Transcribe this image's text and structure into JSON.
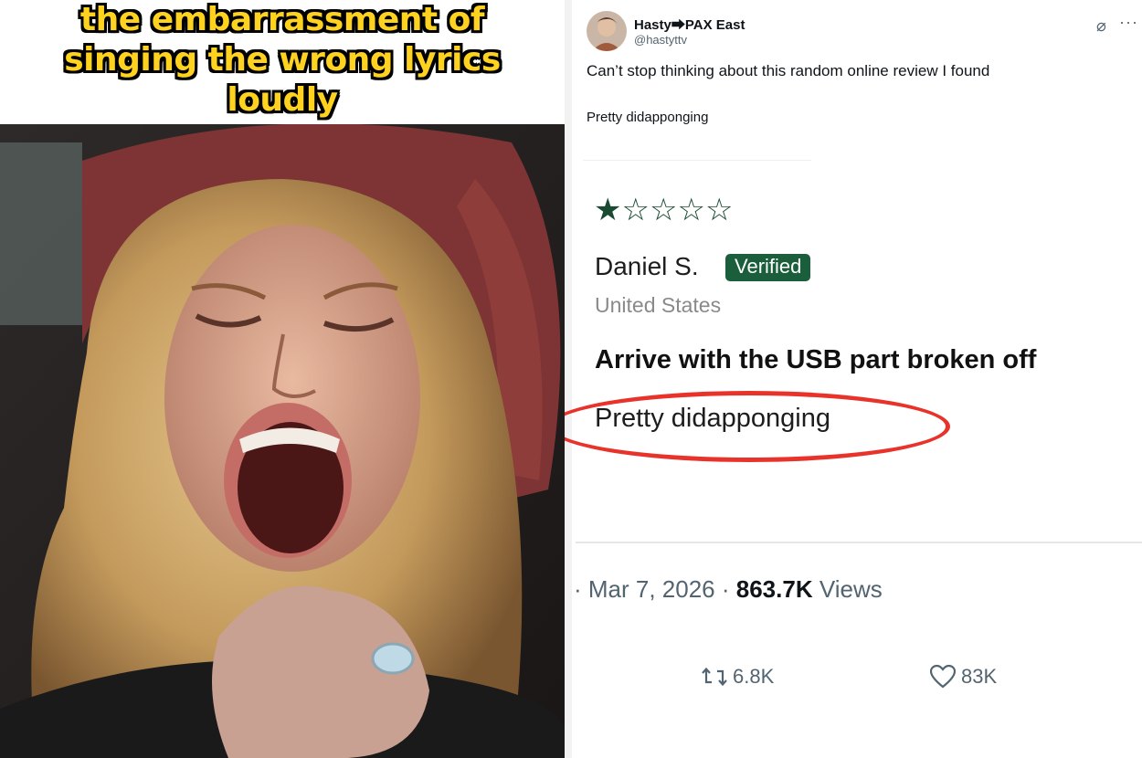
{
  "meme": {
    "caption_lines": [
      "the embarrassment of",
      "singing the wrong lyrics",
      "loudly"
    ]
  },
  "tweet": {
    "author": {
      "display_name": "Hasty⮕PAX East",
      "handle": "@hastyttv"
    },
    "text": "Can’t stop thinking about this random online review I found",
    "subtext": "Pretty didapponging",
    "review": {
      "rating": 1,
      "max_rating": 5,
      "reviewer": "Daniel S.",
      "badge": "Verified",
      "country": "United States",
      "title": "Arrive with the USB part broken off",
      "body": "Pretty didapponging"
    },
    "meta": {
      "date": "Mar 7, 2026",
      "separator": " · ",
      "views_count": "863.7K",
      "views_label": "Views"
    },
    "actions": {
      "retweets": "6.8K",
      "likes": "83K"
    },
    "icons": [
      "grok-icon",
      "more-icon",
      "retweet-icon",
      "heart-icon",
      "star-filled-icon",
      "star-outline-icon"
    ],
    "colors": {
      "caption_fill": "#ffd21f",
      "verified_badge": "#1b5e3b",
      "star": "#1a4a32",
      "annotation_circle": "#e8322a"
    }
  }
}
